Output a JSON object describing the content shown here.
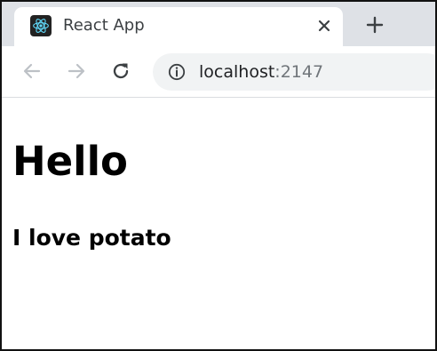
{
  "browser": {
    "tab": {
      "title": "React App",
      "favicon_icon": "react-logo-icon",
      "close_icon": "close-icon"
    },
    "new_tab_icon": "plus-icon",
    "toolbar": {
      "back_icon": "arrow-left-icon",
      "forward_icon": "arrow-right-icon",
      "reload_icon": "reload-icon",
      "site_info_icon": "info-circle-icon",
      "address": {
        "host": "localhost",
        "port": ":2147"
      }
    }
  },
  "page": {
    "heading": "Hello",
    "subheading": "I love potato"
  },
  "colors": {
    "tab_strip": "#dee1e6",
    "omnibox": "#f1f3f4",
    "react_logo": "#61dafb"
  }
}
